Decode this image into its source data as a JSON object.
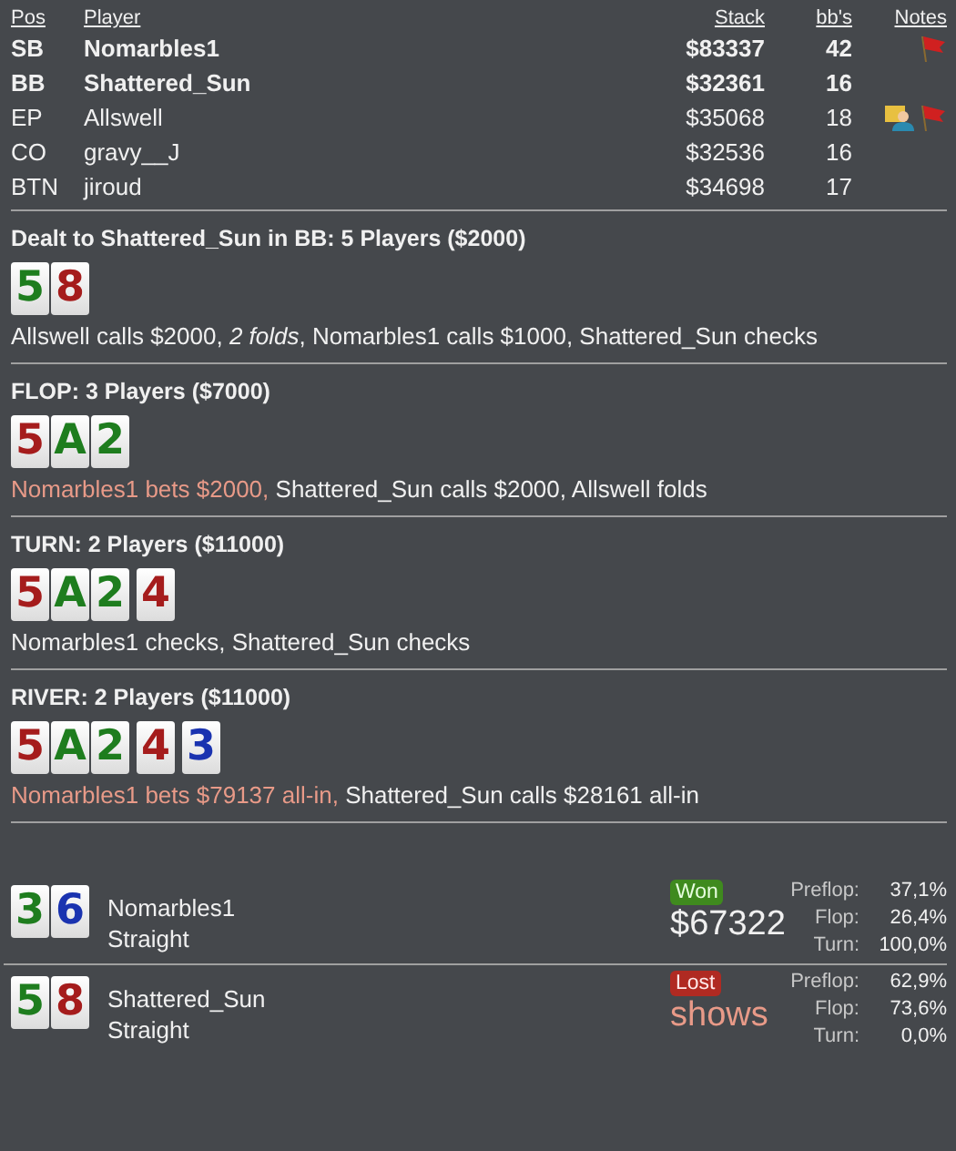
{
  "players": {
    "columns": [
      "Pos",
      "Player",
      "Stack",
      "bb's",
      "Notes"
    ],
    "rows": [
      {
        "pos": "SB",
        "name": "Nomarbles1",
        "stack": "$83337",
        "bbs": "42",
        "bold": true,
        "noted": false,
        "tagged": true
      },
      {
        "pos": "BB",
        "name": "Shattered_Sun",
        "stack": "$32361",
        "bbs": "16",
        "bold": true,
        "noted": false,
        "tagged": false
      },
      {
        "pos": "EP",
        "name": "Allswell",
        "stack": "$35068",
        "bbs": "18",
        "bold": false,
        "noted": true,
        "tagged": true
      },
      {
        "pos": "CO",
        "name": "gravy__J",
        "stack": "$32536",
        "bbs": "16",
        "bold": false,
        "noted": false,
        "tagged": false
      },
      {
        "pos": "BTN",
        "name": "jiroud",
        "stack": "$34698",
        "bbs": "17",
        "bold": false,
        "noted": false,
        "tagged": false
      }
    ]
  },
  "streets": [
    {
      "title": "Dealt to Shattered_Sun in BB: 5 Players ($2000)",
      "cards": [
        {
          "rank": "5",
          "color": "#1e7d1e"
        },
        {
          "rank": "8",
          "color": "#a51c1c"
        }
      ],
      "actions": [
        {
          "text": "Allswell calls $2000, *2 folds*, Nomarbles1 calls $1000, Shattered_Sun checks",
          "kind": "plain"
        }
      ]
    },
    {
      "title": "FLOP: 3 Players ($7000)",
      "cards": [
        {
          "rank": "5",
          "color": "#a51c1c"
        },
        {
          "rank": "A",
          "color": "#1e7d1e"
        },
        {
          "rank": "2",
          "color": "#1e7d1e"
        }
      ],
      "actions": [
        {
          "text": "Nomarbles1 bets $2000,",
          "kind": "bet"
        },
        {
          "text": "Shattered_Sun calls $2000, Allswell folds",
          "kind": "plain"
        }
      ]
    },
    {
      "title": "TURN: 2 Players ($11000)",
      "cards": [
        {
          "rank": "5",
          "color": "#a51c1c"
        },
        {
          "rank": "A",
          "color": "#1e7d1e"
        },
        {
          "rank": "2",
          "color": "#1e7d1e"
        },
        {
          "rank": "4",
          "color": "#a51c1c"
        }
      ],
      "actions": [
        {
          "text": "Nomarbles1 checks, Shattered_Sun checks",
          "kind": "plain"
        }
      ]
    },
    {
      "title": "RIVER: 2 Players ($11000)",
      "cards": [
        {
          "rank": "5",
          "color": "#a51c1c"
        },
        {
          "rank": "A",
          "color": "#1e7d1e"
        },
        {
          "rank": "2",
          "color": "#1e7d1e"
        },
        {
          "rank": "4",
          "color": "#a51c1c"
        },
        {
          "rank": "3",
          "color": "#1a33b0"
        }
      ],
      "actions": [
        {
          "text": "Nomarbles1 bets $79137 all-in,",
          "kind": "bet"
        },
        {
          "text": "Shattered_Sun calls $28161 all-in",
          "kind": "plain"
        }
      ]
    }
  ],
  "results": [
    {
      "cards": [
        {
          "rank": "3",
          "color": "#1e7d1e"
        },
        {
          "rank": "6",
          "color": "#1a33b0"
        }
      ],
      "name": "Nomarbles1",
      "hand": "Straight",
      "outcome": "Won",
      "kind": "won",
      "amount": "$67322",
      "equity": [
        {
          "label": "Preflop:",
          "value": "37,1%"
        },
        {
          "label": "Flop:",
          "value": "26,4%"
        },
        {
          "label": "Turn:",
          "value": "100,0%"
        }
      ]
    },
    {
      "cards": [
        {
          "rank": "5",
          "color": "#1e7d1e"
        },
        {
          "rank": "8",
          "color": "#a51c1c"
        }
      ],
      "name": "Shattered_Sun",
      "hand": "Straight",
      "outcome": "Lost",
      "kind": "lost",
      "amount": "shows",
      "equity": [
        {
          "label": "Preflop:",
          "value": "62,9%"
        },
        {
          "label": "Flop:",
          "value": "73,6%"
        },
        {
          "label": "Turn:",
          "value": "0,0%"
        }
      ]
    }
  ]
}
